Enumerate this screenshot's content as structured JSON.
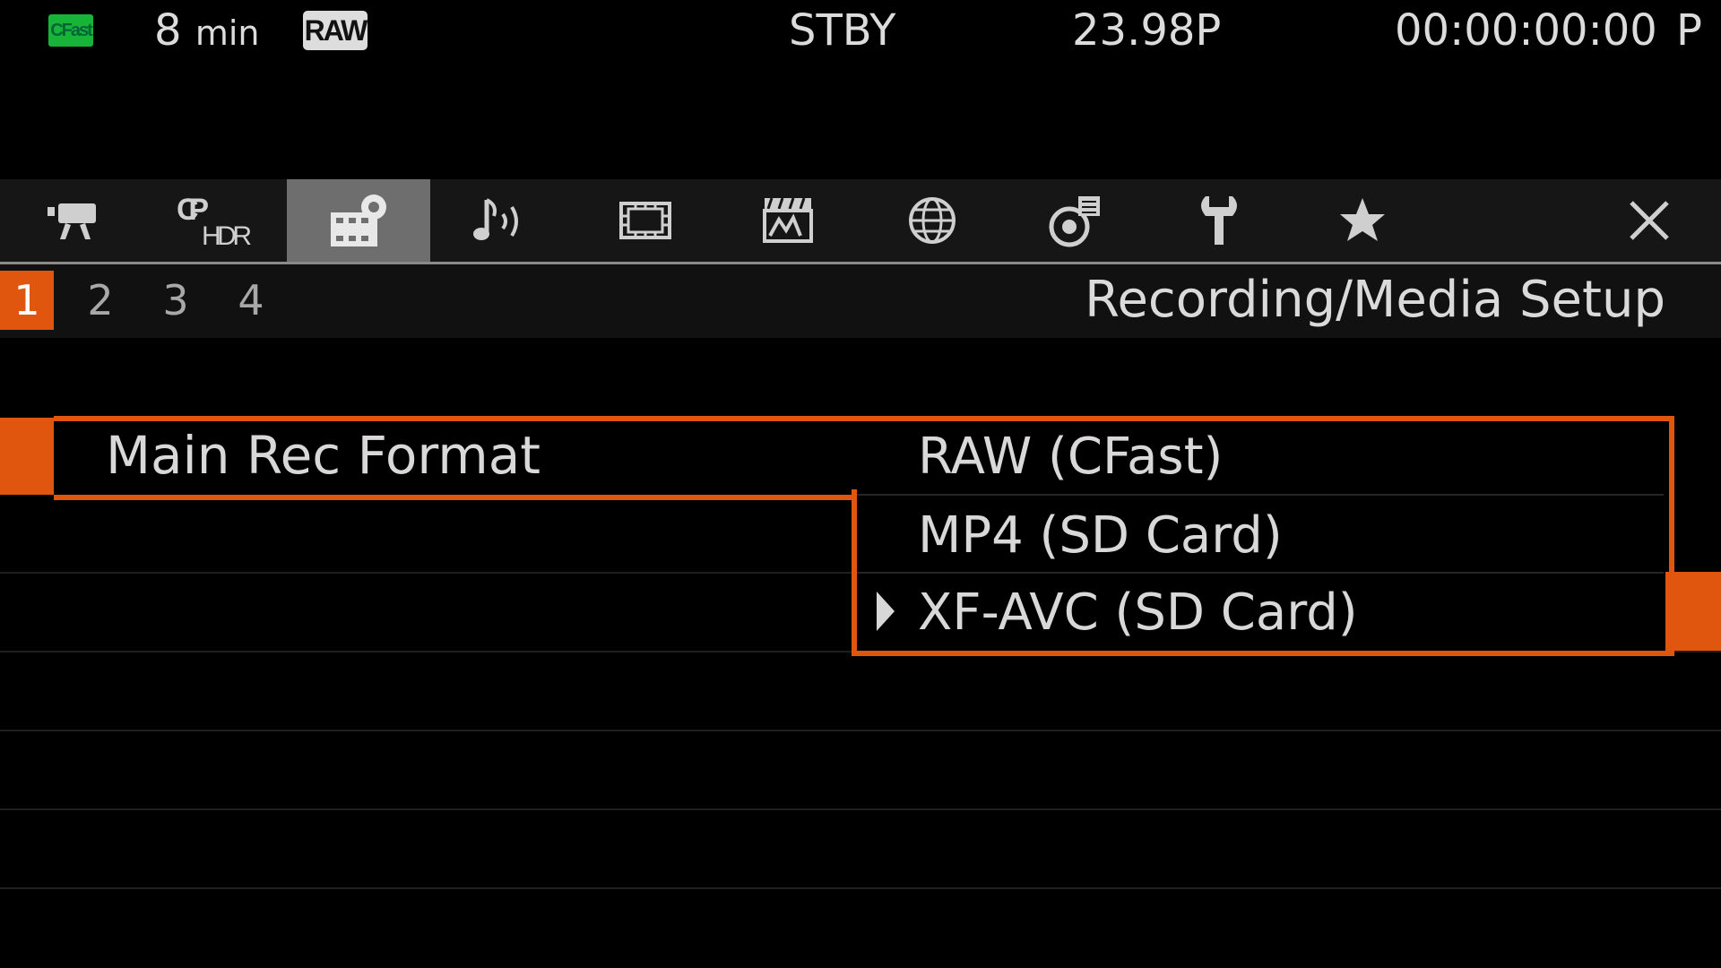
{
  "status_bar": {
    "media_badge": "CFast",
    "remaining_value": "8",
    "remaining_unit": "min",
    "format_badge": "RAW",
    "mode": "STBY",
    "frame_rate": "23.98P",
    "timecode": "00:00:00:00",
    "timecode_mode": "P"
  },
  "tabs": [
    {
      "name": "camera-setup-icon"
    },
    {
      "name": "cp-hdr-icon"
    },
    {
      "name": "recording-media-setup-icon",
      "active": true
    },
    {
      "name": "audio-setup-icon"
    },
    {
      "name": "lcd-vf-setup-icon"
    },
    {
      "name": "assistance-functions-icon"
    },
    {
      "name": "network-settings-icon"
    },
    {
      "name": "monitoring-setup-icon"
    },
    {
      "name": "system-setup-icon"
    },
    {
      "name": "my-menu-icon"
    },
    {
      "name": "close-icon"
    }
  ],
  "pages": [
    "1",
    "2",
    "3",
    "4"
  ],
  "active_page": "1",
  "menu_title": "Recording/Media Setup",
  "setting": {
    "label": "Main Rec Format",
    "options": [
      "RAW (CFast)",
      "MP4 (SD Card)",
      "XF-AVC (SD Card)"
    ],
    "selected_index": 2
  },
  "colors": {
    "accent": "#e0560f",
    "media_badge": "#18b43a",
    "active_tab": "#6e6e6e"
  }
}
